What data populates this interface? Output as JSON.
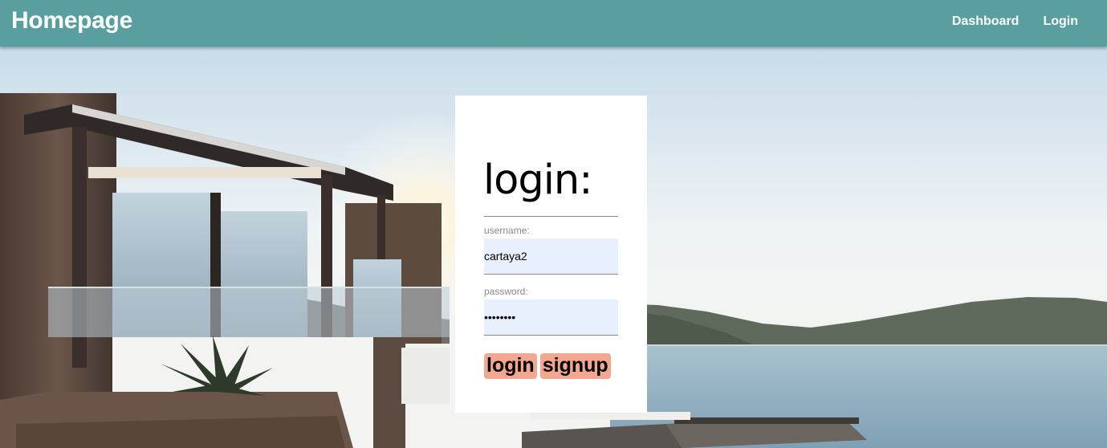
{
  "navbar": {
    "brand": "Homepage",
    "links": [
      {
        "label": "Dashboard"
      },
      {
        "label": "Login"
      }
    ],
    "color": "#5a9fa0"
  },
  "login_form": {
    "title": "login:",
    "username": {
      "label": "username:",
      "value": "cartaya2"
    },
    "password": {
      "label": "password:",
      "value": "cartaya2"
    },
    "buttons": {
      "login": "login",
      "signup": "signup"
    },
    "button_color": "#f4a790",
    "input_background": "#e8f0fe"
  },
  "background": {
    "description_icon": "villa-seaside-photo"
  }
}
